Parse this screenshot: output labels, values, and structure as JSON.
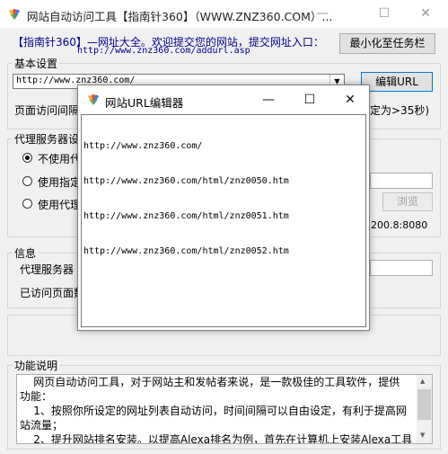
{
  "main": {
    "title": "网站自动访问工具【指南针360】（WWW.ZNZ360.COM）...",
    "header_text": "【指南针360】—网址大全。欢迎提交您的网站，提交网址入口：",
    "header_url": "http://www.znz360.com/addurl.asp",
    "minimize_tray": "最小化至任务栏",
    "basic_settings": {
      "legend": "基本设置",
      "url_value": "http://www.znz360.com/",
      "edit_url": "编辑URL",
      "interval_label": "页面访问间隔",
      "interval_hint": "定为>35秒)"
    },
    "proxy": {
      "legend": "代理服务器设",
      "option_none": "不使用代",
      "option_specified": "使用指定",
      "option_proxy": "使用代理",
      "browse": "浏览",
      "address_fragment": "200.8:8080"
    },
    "info": {
      "legend": "信息",
      "proxy_label": "代理服务器",
      "visited_label": "已访问页面数"
    },
    "functions": {
      "legend": "功能说明",
      "line1": "    网页自动访问工具，对于网站主和发帖者来说，是一款极佳的工具软件，提供",
      "line2": "功能：",
      "line3": "    1、按照你所设定的网址列表自动访问，时间间隔可以自由设定，有利于提高网",
      "line4": "站流量；",
      "line5": "    2、提升网站排名安装。以提高Alexa排名为例，首先在计算机上安装Alexa工具"
    }
  },
  "dialog": {
    "title": "网站URL编辑器",
    "lines": [
      "http://www.znz360.com/",
      "http://www.znz360.com/html/znz0050.htm",
      "http://www.znz360.com/html/znz0051.htm",
      "http://www.znz360.com/html/znz0052.htm"
    ]
  },
  "icons": {
    "window_controls": [
      "minimize-icon",
      "maximize-icon",
      "close-icon"
    ],
    "logo_colors": [
      "#f2b01e",
      "#e8453c",
      "#3b7dd8",
      "#34a853"
    ]
  }
}
